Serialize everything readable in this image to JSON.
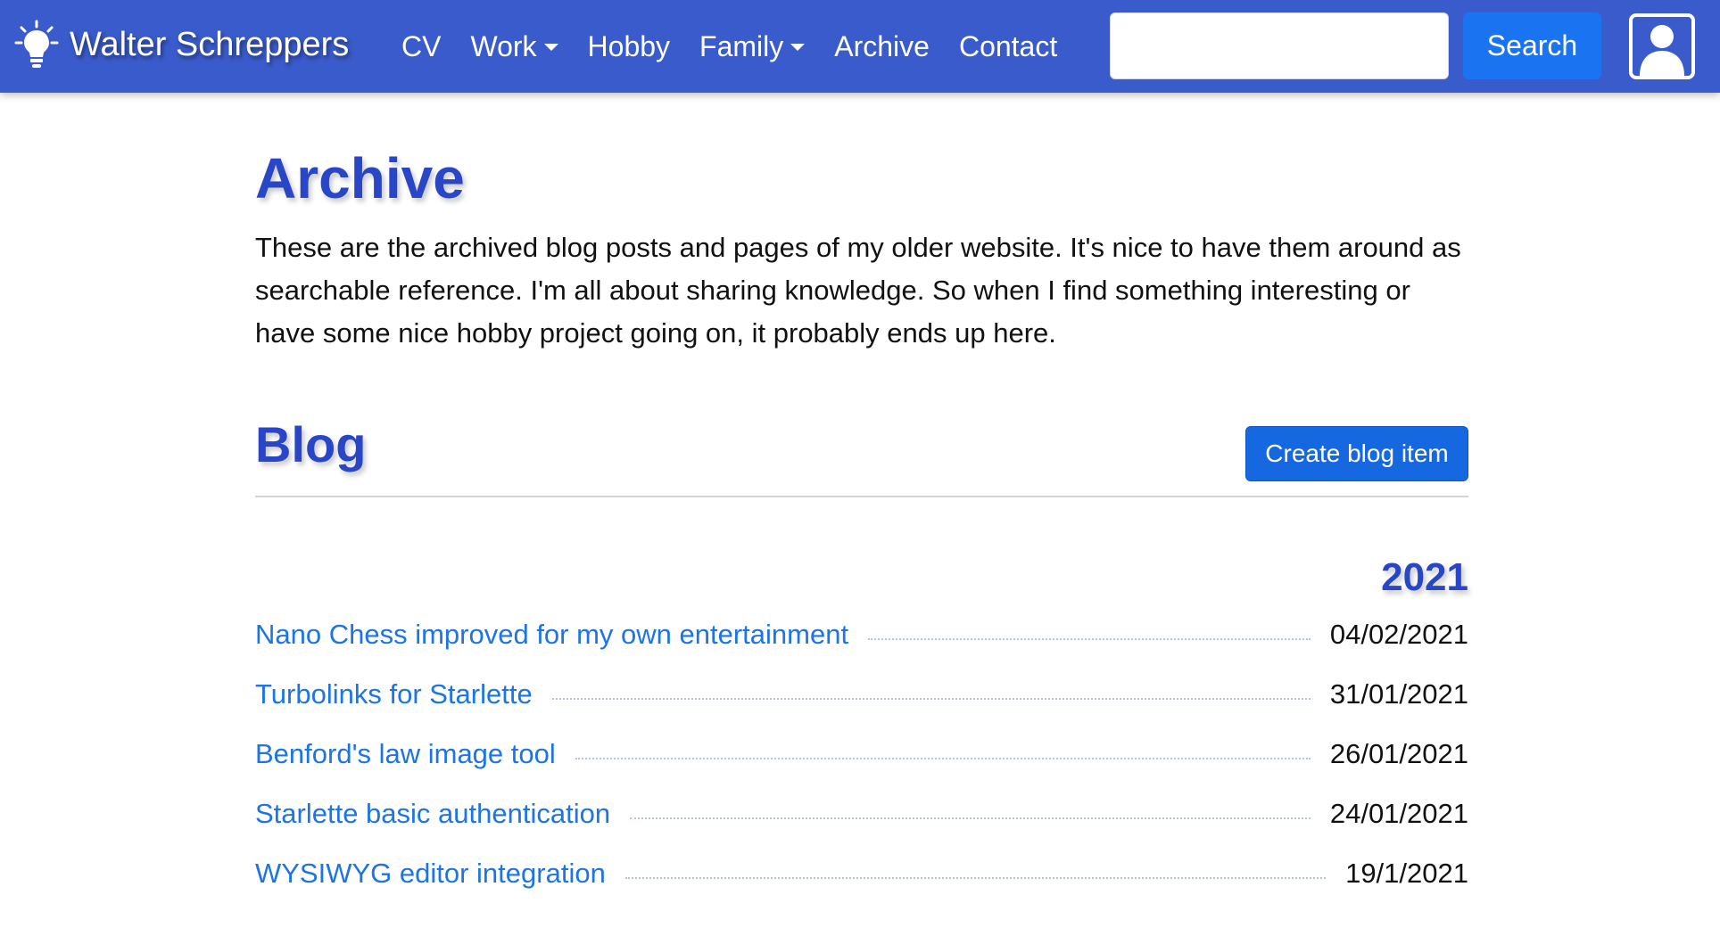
{
  "navbar": {
    "brand": "Walter Schreppers",
    "links": [
      {
        "label": "CV",
        "dropdown": false
      },
      {
        "label": "Work",
        "dropdown": true
      },
      {
        "label": "Hobby",
        "dropdown": false
      },
      {
        "label": "Family",
        "dropdown": true
      },
      {
        "label": "Archive",
        "dropdown": false
      },
      {
        "label": "Contact",
        "dropdown": false
      }
    ],
    "search": {
      "value": "",
      "placeholder": "",
      "button_label": "Search"
    },
    "icons": {
      "brand": "lightbulb-icon",
      "user": "user-icon"
    }
  },
  "main": {
    "title": "Archive",
    "intro": "These are the archived blog posts and pages of my older website. It's nice to have them around as searchable reference. I'm all about sharing knowledge. So when I find something interesting or have some nice hobby project going on, it probably ends up here.",
    "blog": {
      "title": "Blog",
      "create_button": "Create blog item",
      "year": "2021",
      "posts": [
        {
          "title": "Nano Chess improved for my own entertainment",
          "date": "04/02/2021"
        },
        {
          "title": "Turbolinks for Starlette",
          "date": "31/01/2021"
        },
        {
          "title": "Benford's law image tool",
          "date": "26/01/2021"
        },
        {
          "title": "Starlette basic authentication",
          "date": "24/01/2021"
        },
        {
          "title": "WYSIWYG editor integration",
          "date": "19/1/2021"
        }
      ]
    }
  },
  "colors": {
    "navbar_bg": "#3a5bcb",
    "heading": "#2946c7",
    "link": "#1d74e6",
    "button": "#1a73f0"
  }
}
